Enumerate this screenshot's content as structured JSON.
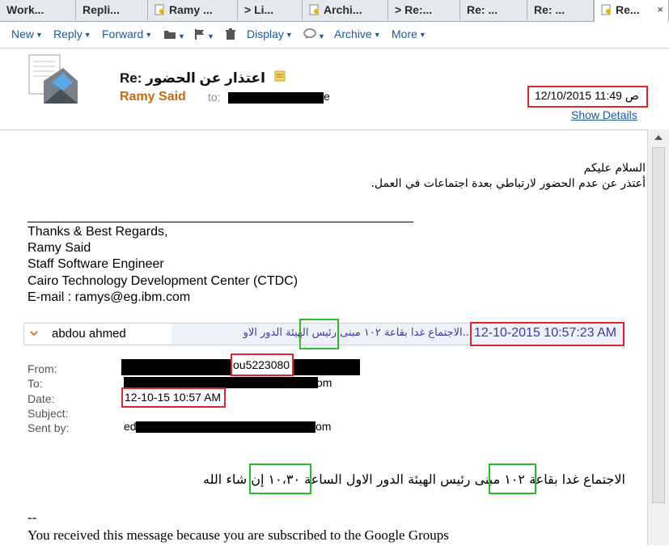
{
  "tabs": [
    {
      "label": "Work..."
    },
    {
      "label": "Repli..."
    },
    {
      "label": "Ramy ..."
    },
    {
      "label": "> Li..."
    },
    {
      "label": "Archi..."
    },
    {
      "label": "> Re:..."
    },
    {
      "label": "Re: ..."
    },
    {
      "label": "Re: ..."
    },
    {
      "label": "Re..."
    }
  ],
  "tab_close": "×",
  "toolbar": {
    "new": "New",
    "reply": "Reply",
    "forward": "Forward",
    "display": "Display",
    "archive": "Archive",
    "more": "More"
  },
  "header": {
    "subject": "Re: اعتذار عن الحضور",
    "from_name": "Ramy Said",
    "to_label": "to:",
    "to_value_tail": "e",
    "date": "12/10/2015 11:49 ص",
    "show_details": "Show Details"
  },
  "body": {
    "greeting": "السلام عليكم",
    "apology": "أعتذر عن عدم الحضور لارتباطي بعدة اجتماعات في العمل.",
    "signature": [
      "Thanks & Best Regards,",
      "Ramy Said",
      "Staff Software Engineer",
      "Cairo Technology Development Center (CTDC)",
      "E-mail : ramys@eg.ibm.com"
    ]
  },
  "thread": {
    "sender": "abdou ahmed",
    "snippet": "...الاجتماع غدا بقاعة ١٠٢ مبنى رئيس الهيئة الدور الاو",
    "datetime": "12-10-2015 10:57:23 AM"
  },
  "quoted": {
    "labels": {
      "from": "From:",
      "to": "To:",
      "date": "Date:",
      "subject": "Subject:",
      "sent_by": "Sent by:"
    },
    "from_visible": "ou5223080",
    "to_tail": "om",
    "date": "12-10-15 10:57 AM",
    "sent_by_head": "ed",
    "sent_by_tail": "com",
    "message": "الاجتماع غدا بقاعة ١٠٢ مبنى رئيس الهيئة الدور الاول الساعة ١٠،٣٠ إن شاء الله",
    "sep": "--",
    "footer": "You received this message because you are subscribed to the Google Groups"
  },
  "colors": {
    "accent": "#1b5a9a",
    "sender": "#c46a12",
    "highlight_red": "#e0262b",
    "highlight_green": "#2dbb2d"
  }
}
